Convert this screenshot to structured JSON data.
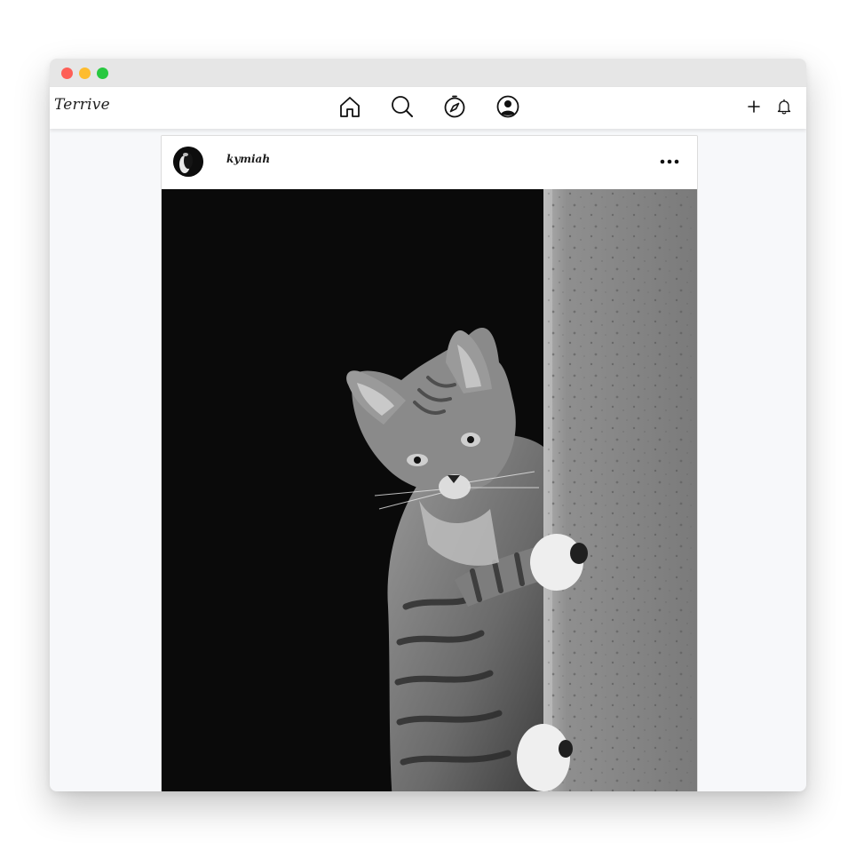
{
  "app": {
    "logo_text": "Terrive"
  },
  "navbar": {
    "center_icons": [
      "home-icon",
      "search-icon",
      "compass-icon",
      "profile-icon"
    ],
    "right_icons": [
      "plus-icon",
      "bell-icon"
    ]
  },
  "post": {
    "username": "kymiah",
    "menu_icon": "more-icon",
    "image_description": "cat"
  },
  "colors": {
    "window_close": "#fe5f57",
    "window_minimize": "#febc2e",
    "window_zoom": "#28c840",
    "page_background": "#f7f8fa"
  }
}
